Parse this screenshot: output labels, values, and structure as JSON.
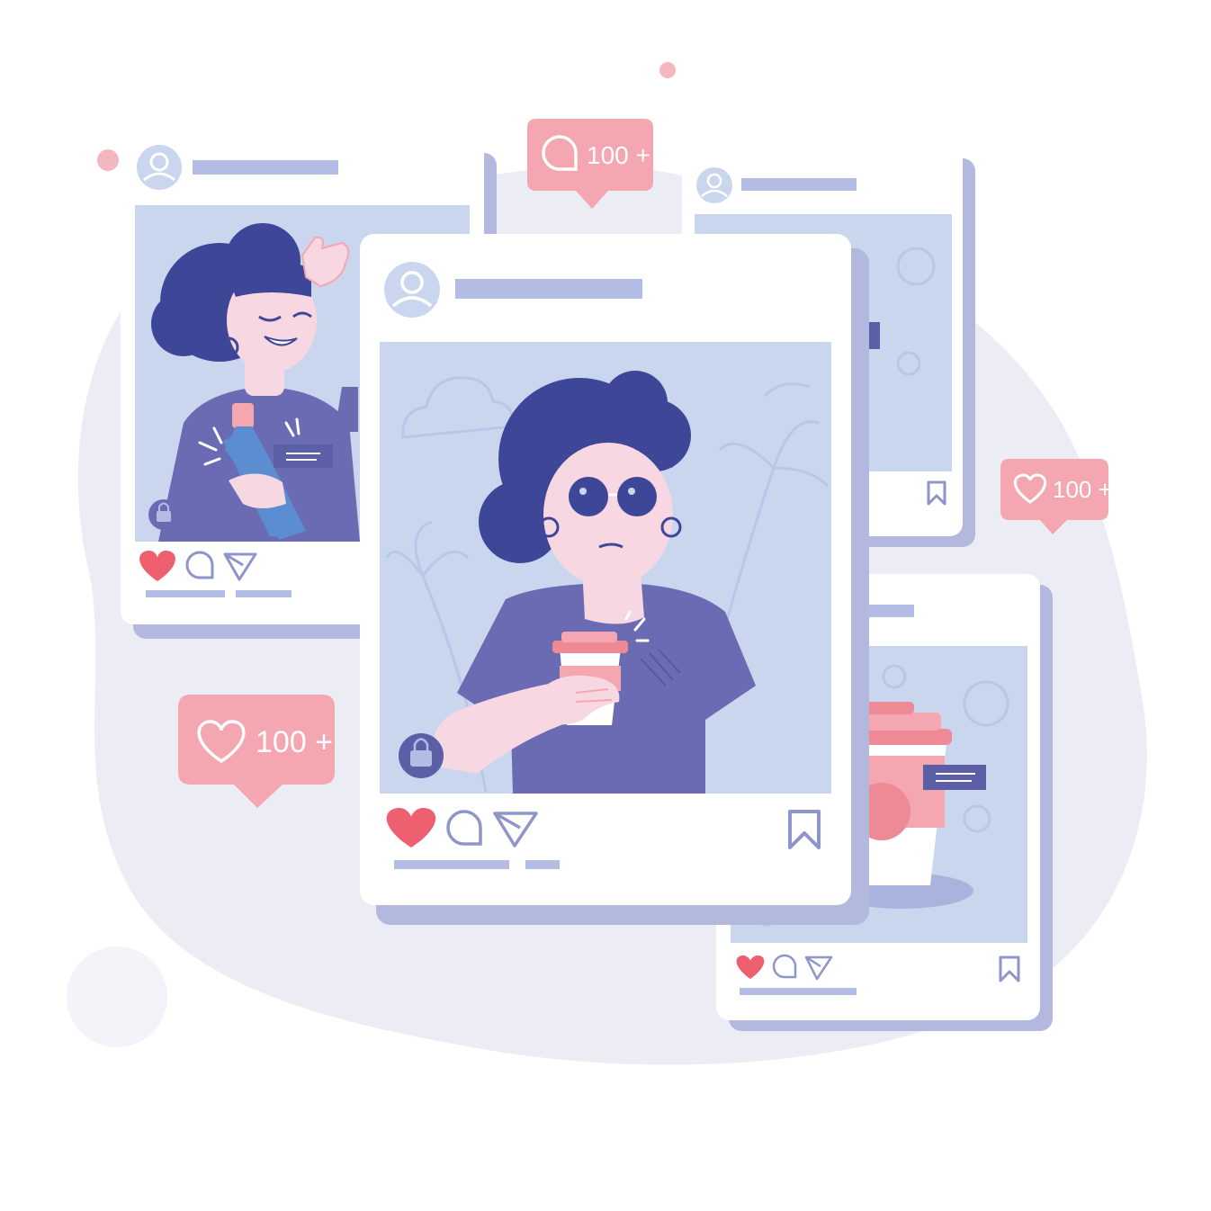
{
  "scene": {
    "name": "social-media-feed-illustration",
    "colors": {
      "background": "#ffffff",
      "blob": "#ececf5",
      "card": "#ffffff",
      "card_shadow": "#b3b8df",
      "photo_bg": "#c9d6ee",
      "placeholder_bar": "#b3bce3",
      "avatar": "#c9d6ee",
      "accent_pink": "#f4a7b0",
      "heart_red": "#ee5f6f",
      "hair": "#3e4797",
      "shirt": "#6b6bb3",
      "skin": "#f7d7e2"
    }
  },
  "badges": {
    "top_comment": {
      "icon": "comment-icon",
      "count": "100 +"
    },
    "right_like": {
      "icon": "heart-icon",
      "count": "100 +"
    },
    "left_like": {
      "icon": "heart-icon",
      "count": "100 +"
    }
  },
  "posts": [
    {
      "id": "left-post",
      "liked": true,
      "actions": [
        "heart-icon",
        "comment-icon",
        "send-icon"
      ],
      "tag_icon": "shopping-bag-icon"
    },
    {
      "id": "main-post",
      "liked": true,
      "actions": [
        "heart-icon",
        "comment-icon",
        "send-icon",
        "bookmark-icon"
      ],
      "tag_icon": "shopping-bag-icon"
    },
    {
      "id": "top-right-post",
      "liked": false,
      "actions": [
        "bookmark-icon"
      ]
    },
    {
      "id": "bottom-right-post",
      "liked": true,
      "actions": [
        "heart-icon",
        "comment-icon",
        "send-icon",
        "bookmark-icon"
      ]
    }
  ]
}
